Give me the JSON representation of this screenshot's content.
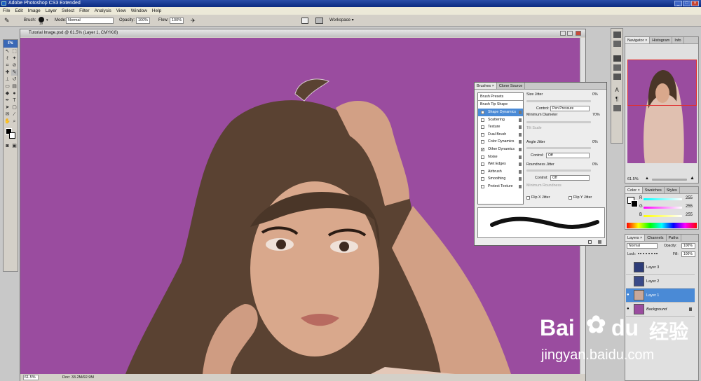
{
  "app": {
    "title": "Adobe Photoshop CS3 Extended"
  },
  "menu": [
    "File",
    "Edit",
    "Image",
    "Layer",
    "Select",
    "Filter",
    "Analysis",
    "View",
    "Window",
    "Help"
  ],
  "options": {
    "brush_label": "Brush:",
    "brush_size": "19",
    "mode_label": "Mode:",
    "mode_value": "Normal",
    "opacity_label": "Opacity:",
    "opacity_value": "100%",
    "flow_label": "Flow:",
    "flow_value": "100%",
    "workspace_label": "Workspace ▾"
  },
  "document": {
    "title": "Tutorial Image.psd @ 61.5% (Layer 1, CMYK/8)",
    "zoom": "61.5%",
    "doc_info": "Doc: 33.2M/92.9M"
  },
  "brushes": {
    "tabs": [
      "Brushes ×",
      "Clone Source"
    ],
    "presets_label": "Brush Presets",
    "tip_shape_label": "Brush Tip Shape",
    "options": [
      {
        "label": "Shape Dynamics",
        "checked": true,
        "selected": true
      },
      {
        "label": "Scattering",
        "checked": false
      },
      {
        "label": "Texture",
        "checked": false
      },
      {
        "label": "Dual Brush",
        "checked": false
      },
      {
        "label": "Color Dynamics",
        "checked": false
      },
      {
        "label": "Other Dynamics",
        "checked": true
      },
      {
        "label": "Noise",
        "checked": false
      },
      {
        "label": "Wet Edges",
        "checked": false
      },
      {
        "label": "Airbrush",
        "checked": false
      },
      {
        "label": "Smoothing",
        "checked": false
      },
      {
        "label": "Protect Texture",
        "checked": false
      }
    ],
    "size_jitter_label": "Size Jitter",
    "size_jitter_value": "0%",
    "control_label": "Control:",
    "control1_value": "Pen Pressure",
    "min_diameter_label": "Minimum Diameter",
    "min_diameter_value": "70%",
    "tilt_scale_label": "Tilt Scale",
    "angle_jitter_label": "Angle Jitter",
    "angle_jitter_value": "0%",
    "control2_value": "Off",
    "roundness_jitter_label": "Roundness Jitter",
    "roundness_jitter_value": "0%",
    "control3_value": "Off",
    "min_roundness_label": "Minimum Roundness",
    "flip_x_label": "Flip X Jitter",
    "flip_y_label": "Flip Y Jitter"
  },
  "navigator": {
    "tabs": [
      "Navigator ×",
      "Histogram",
      "Info"
    ],
    "zoom": "61.5%"
  },
  "color": {
    "tabs": [
      "Color ×",
      "Swatches",
      "Styles"
    ],
    "r_label": "R",
    "r_value": "255",
    "g_label": "G",
    "g_value": "255",
    "b_label": "B",
    "b_value": "255"
  },
  "layers": {
    "tabs": [
      "Layers ×",
      "Channels",
      "Paths"
    ],
    "blend_mode": "Normal",
    "opacity_label": "Opacity:",
    "opacity_value": "100%",
    "lock_label": "Lock:",
    "fill_label": "Fill:",
    "fill_value": "100%",
    "items": [
      {
        "name": "Layer 3",
        "visible": false,
        "selected": false
      },
      {
        "name": "Layer 2",
        "visible": false,
        "selected": false
      },
      {
        "name": "Layer 1",
        "visible": true,
        "selected": true
      },
      {
        "name": "Background",
        "visible": true,
        "selected": false
      }
    ]
  },
  "watermark": {
    "brand": "Bai",
    "brand2": "du",
    "cn": "经验",
    "url": "jingyan.baidu.com"
  },
  "colors": {
    "canvas": "#9a4c9f",
    "selection": "#4a8ad6",
    "title_blue": "#1b3f98"
  }
}
